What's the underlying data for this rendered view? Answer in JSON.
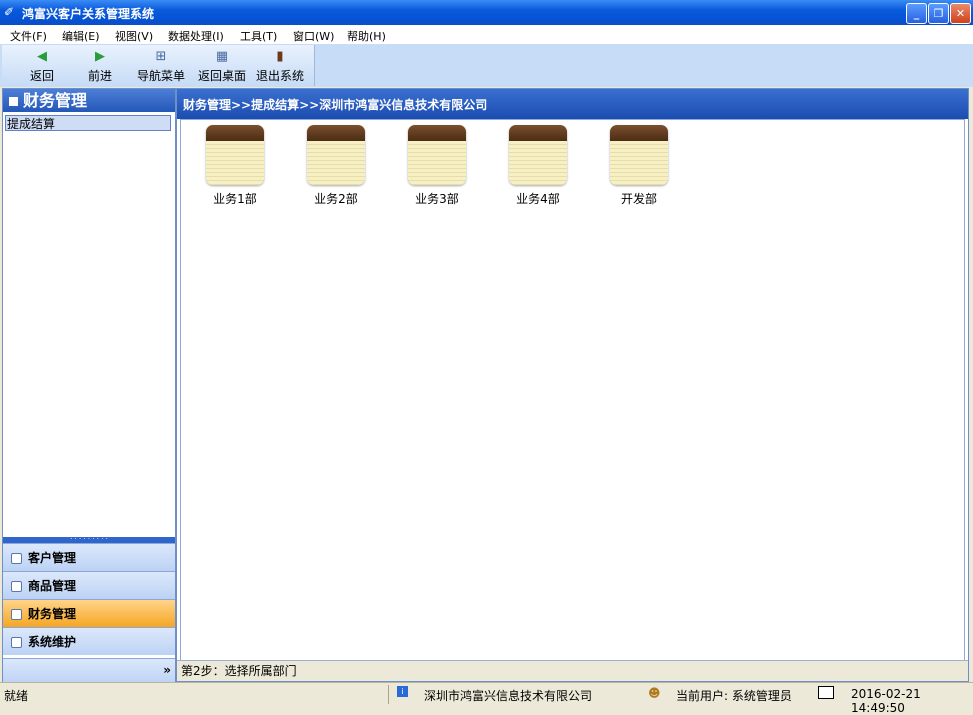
{
  "window": {
    "title": "鸿富兴客户关系管理系统",
    "min": "_",
    "restore": "❐",
    "close": "✕"
  },
  "menu": [
    "文件(F)",
    "编辑(E)",
    "视图(V)",
    "数据处理(I)",
    "工具(T)",
    "窗口(W)",
    "帮助(H)"
  ],
  "toolbar": [
    {
      "label": "返回",
      "icon": "back-arrow-icon"
    },
    {
      "label": "前进",
      "icon": "forward-arrow-icon"
    },
    {
      "label": "导航菜单",
      "icon": "nav-menu-icon"
    },
    {
      "label": "返回桌面",
      "icon": "desktop-icon"
    },
    {
      "label": "退出系统",
      "icon": "exit-door-icon"
    }
  ],
  "sidebar": {
    "title": "财务管理",
    "tree_item": "提成结算",
    "nav": [
      {
        "label": "客户管理"
      },
      {
        "label": "商品管理"
      },
      {
        "label": "财务管理",
        "active": true
      },
      {
        "label": "系统维护"
      }
    ],
    "expand": "»"
  },
  "main": {
    "breadcrumb": "财务管理>>提成结算>>深圳市鸿富兴信息技术有限公司",
    "departments": [
      "业务1部",
      "业务2部",
      "业务3部",
      "业务4部",
      "开发部"
    ],
    "step": "第2步：选择所属部门"
  },
  "status": {
    "ready": "就绪",
    "company": "深圳市鸿富兴信息技术有限公司",
    "user": "当前用户: 系统管理员",
    "datetime": "2016-02-21 14:49:50"
  },
  "colors": {
    "accent": "#0553d6",
    "active_nav": "#f5a623",
    "panel_header": "#2458b8"
  }
}
